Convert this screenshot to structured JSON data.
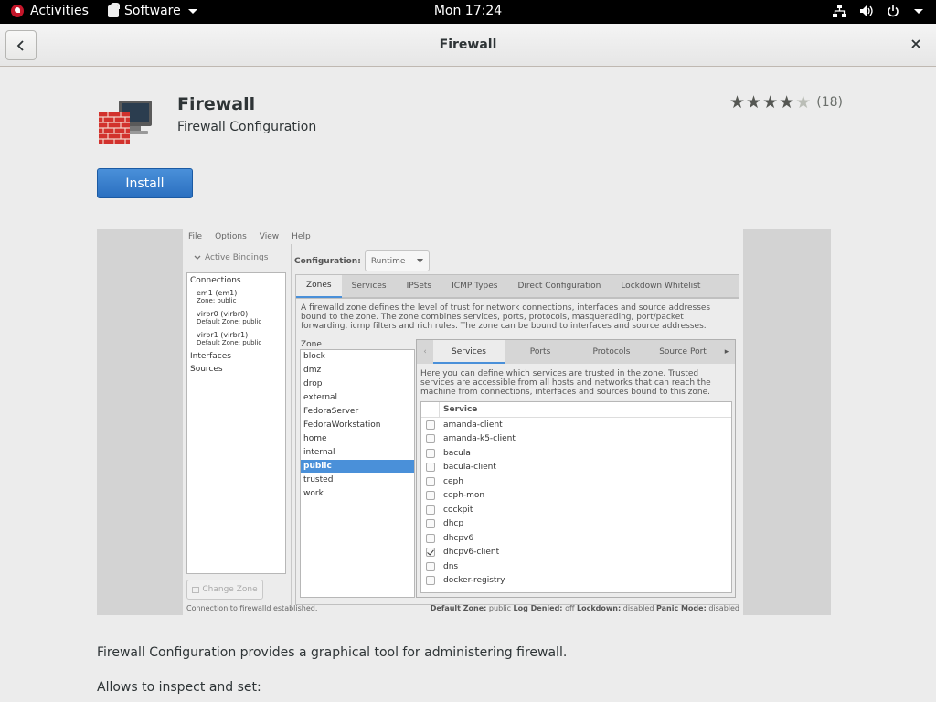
{
  "topbar": {
    "activities": "Activities",
    "app_menu": "Software",
    "clock": "Mon 17:24"
  },
  "header": {
    "title": "Firewall"
  },
  "app": {
    "name": "Firewall",
    "summary": "Firewall Configuration",
    "rating_stars": 4,
    "rating_max": 5,
    "review_count": "(18)",
    "install_label": "Install"
  },
  "screenshot": {
    "menu": [
      "File",
      "Options",
      "View",
      "Help"
    ],
    "active_bindings": "Active Bindings",
    "tree": {
      "connections": "Connections",
      "items": [
        {
          "name": "em1 (em1)",
          "zone": "Zone: public"
        },
        {
          "name": "virbr0 (virbr0)",
          "zone": "Default Zone: public"
        },
        {
          "name": "virbr1 (virbr1)",
          "zone": "Default Zone: public"
        }
      ],
      "interfaces": "Interfaces",
      "sources": "Sources"
    },
    "change_zone": "Change Zone",
    "configuration_label": "Configuration:",
    "configuration_value": "Runtime",
    "tabs": [
      "Zones",
      "Services",
      "IPSets",
      "ICMP Types",
      "Direct Configuration",
      "Lockdown Whitelist"
    ],
    "zone_description": "A firewalld zone defines the level of trust for network connections, interfaces and source addresses bound to the zone. The zone combines services, ports, protocols, masquerading, port/packet forwarding, icmp filters and rich rules. The zone can be bound to interfaces and source addresses.",
    "zone_label": "Zone",
    "zones": [
      "block",
      "dmz",
      "drop",
      "external",
      "FedoraServer",
      "FedoraWorkstation",
      "home",
      "internal",
      "public",
      "trusted",
      "work"
    ],
    "selected_zone": "public",
    "inner_tabs": [
      "Services",
      "Ports",
      "Protocols",
      "Source Port"
    ],
    "services_description": "Here you can define which services are trusted in the zone. Trusted services are accessible from all hosts and networks that can reach the machine from connections, interfaces and sources bound to this zone.",
    "service_header": "Service",
    "services": [
      {
        "name": "amanda-client",
        "checked": false
      },
      {
        "name": "amanda-k5-client",
        "checked": false
      },
      {
        "name": "bacula",
        "checked": false
      },
      {
        "name": "bacula-client",
        "checked": false
      },
      {
        "name": "ceph",
        "checked": false
      },
      {
        "name": "ceph-mon",
        "checked": false
      },
      {
        "name": "cockpit",
        "checked": false
      },
      {
        "name": "dhcp",
        "checked": false
      },
      {
        "name": "dhcpv6",
        "checked": false
      },
      {
        "name": "dhcpv6-client",
        "checked": true
      },
      {
        "name": "dns",
        "checked": false
      },
      {
        "name": "docker-registry",
        "checked": false
      }
    ],
    "status_left": "Connection to firewalld established.",
    "status": {
      "default_zone_label": "Default Zone:",
      "default_zone": "public",
      "log_denied_label": "Log Denied:",
      "log_denied": "off",
      "lockdown_label": "Lockdown:",
      "lockdown": "disabled",
      "panic_label": "Panic Mode:",
      "panic": "disabled"
    }
  },
  "description": {
    "line1": "Firewall Configuration provides a graphical tool for administering firewall.",
    "line2": "Allows to inspect and set:"
  },
  "colors": {
    "install_button": "#3b7fd0",
    "selection": "#4a90d9"
  }
}
